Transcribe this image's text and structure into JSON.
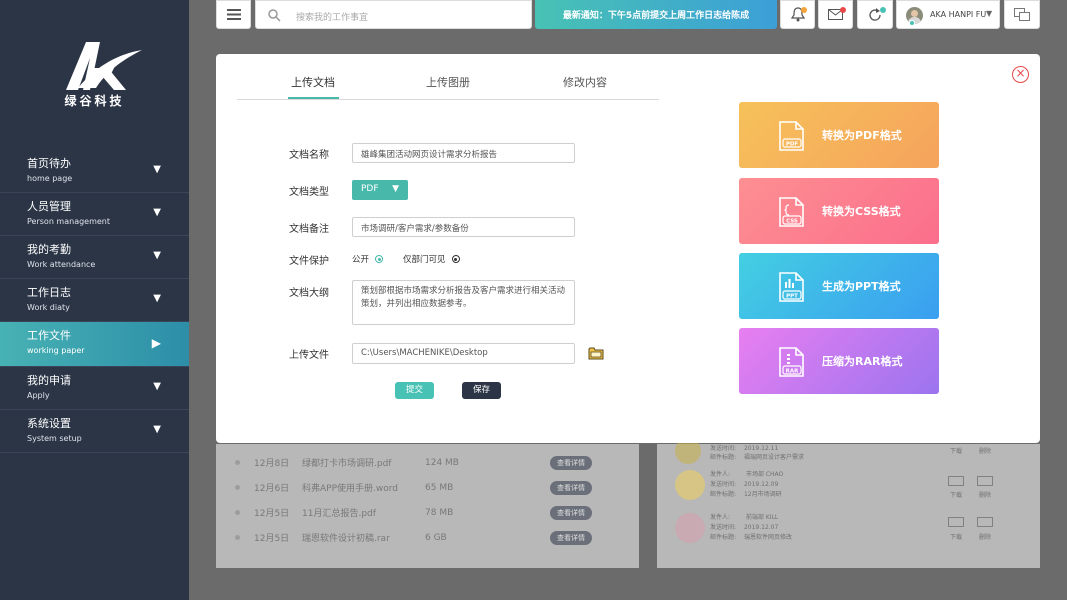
{
  "sidebar": {
    "brand": "绿谷科技",
    "items": [
      {
        "cn": "首页待办",
        "en": "home page",
        "arrow": "▼"
      },
      {
        "cn": "人员管理",
        "en": "Person management",
        "arrow": "▼"
      },
      {
        "cn": "我的考勤",
        "en": "Work attendance",
        "arrow": "▼"
      },
      {
        "cn": "工作日志",
        "en": "Work diaty",
        "arrow": "▼"
      },
      {
        "cn": "工作文件",
        "en": "working paper",
        "arrow": "▶"
      },
      {
        "cn": "我的申请",
        "en": "Apply",
        "arrow": "▼"
      },
      {
        "cn": "系统设置",
        "en": "System setup",
        "arrow": "▼"
      }
    ]
  },
  "topbar": {
    "search_placeholder": "搜索我的工作事宜",
    "notice": "最新通知：下午5点前提交上周工作日志给陈成",
    "user_name": "AKA HANPI FU",
    "user_caret": "▼"
  },
  "background_list": [
    {
      "date": "12月8日",
      "name": "绿都打卡市场调研.pdf",
      "size": "124 MB",
      "action": "查看详情"
    },
    {
      "date": "12月6日",
      "name": "科弗APP使用手册.word",
      "size": "65 MB",
      "action": "查看详情"
    },
    {
      "date": "12月5日",
      "name": "11月汇总报告.pdf",
      "size": "78 MB",
      "action": "查看详情"
    },
    {
      "date": "12月5日",
      "name": "瑞恩软件设计初稿.rar",
      "size": "6 GB",
      "action": "查看详情"
    }
  ],
  "background_cards": [
    {
      "sender_label": "发件人:",
      "sender": "",
      "time_label": "发送时间:",
      "time": "2019.12.11",
      "title_label": "邮件标题:",
      "title": "福瑞网页设计客户需求"
    },
    {
      "sender_label": "发件人:",
      "sender": "市场部 CHAO",
      "time_label": "发送时间:",
      "time": "2019.12.09",
      "title_label": "邮件标题:",
      "title": "12月市场调研"
    },
    {
      "sender_label": "发件人:",
      "sender": "前端部 KILL",
      "time_label": "发送时间:",
      "time": "2019.12.07",
      "title_label": "邮件标题:",
      "title": "瑞恩软件网页修改"
    }
  ],
  "card_actions": {
    "download": "下载",
    "delete": "删除"
  },
  "modal": {
    "tabs": [
      "上传文档",
      "上传图册",
      "修改内容"
    ],
    "active_tab": 0,
    "close": "×",
    "fields": {
      "name_label": "文档名称",
      "name_value": "雄峰集团活动网页设计需求分析报告",
      "type_label": "文档类型",
      "type_value": "PDF",
      "type_caret": "▼",
      "note_label": "文档备注",
      "note_value": "市场调研/客户需求/参数备份",
      "protect_label": "文件保护",
      "protect_options": [
        "公开",
        "仅部门可见"
      ],
      "outline_label": "文档大纲",
      "outline_value": "策划部根据市场需求分析报告及客户需求进行相关活动策划，并列出相应数据参考。",
      "upload_label": "上传文件",
      "upload_value": "C:\\Users\\MACHENIKE\\Desktop"
    },
    "submit": "提交",
    "save": "保存",
    "convert": [
      {
        "label": "转换为PDF格式",
        "tag": "PDF",
        "from": "#f6c15a",
        "to": "#f5a35c"
      },
      {
        "label": "转换为CSS格式",
        "tag": "CSS",
        "from": "#fd8f92",
        "to": "#fb6e8c"
      },
      {
        "label": "生成为PPT格式",
        "tag": "PPT",
        "from": "#43cfe2",
        "to": "#3a9ef0"
      },
      {
        "label": "压缩为RAR格式",
        "tag": "RAR",
        "from": "#e87ff0",
        "to": "#9b74ef"
      }
    ]
  },
  "colors": {
    "sidebar": "#2b3546",
    "accent": "#48b8ab",
    "danger": "#e84848"
  }
}
